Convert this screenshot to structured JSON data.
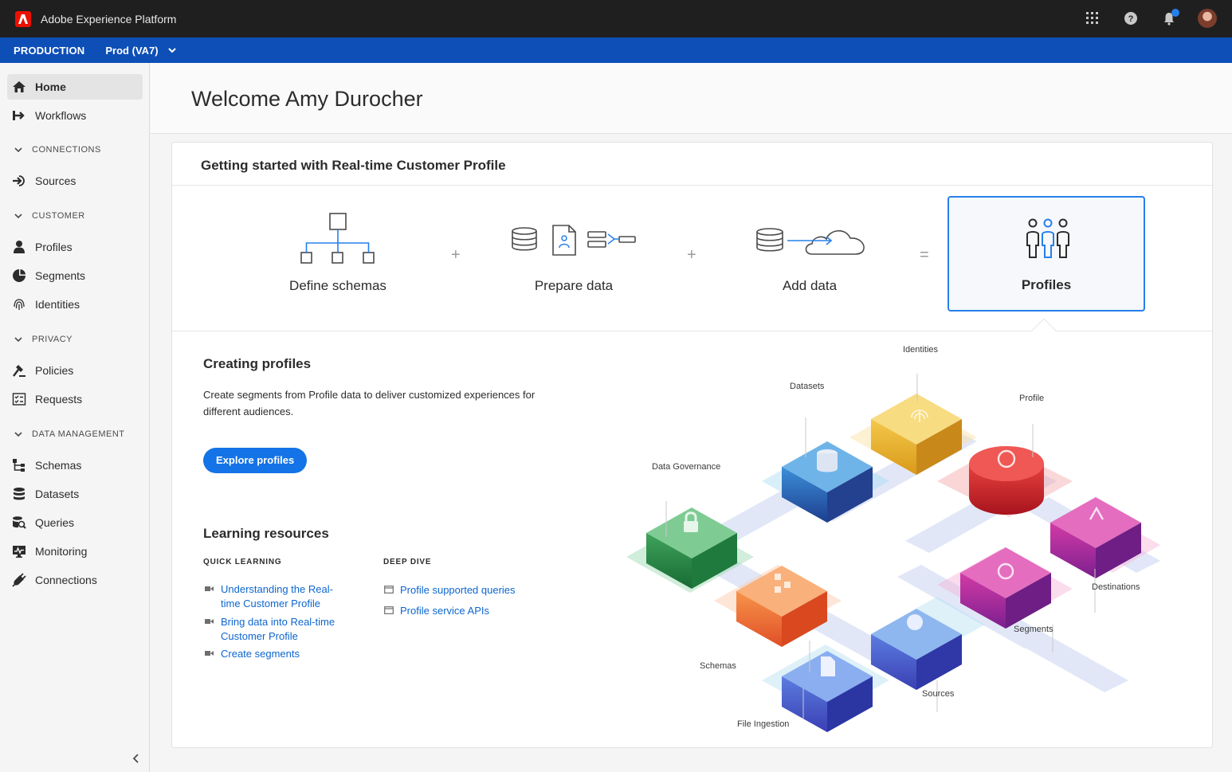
{
  "header": {
    "app_title": "Adobe Experience Platform",
    "icons": [
      "apps-grid-icon",
      "help-icon",
      "notifications-icon",
      "user-avatar"
    ]
  },
  "envbar": {
    "environment": "PRODUCTION",
    "sandbox": "Prod (VA7)"
  },
  "sidebar": {
    "items": [
      {
        "label": "Home",
        "icon": "home-icon",
        "active": true
      },
      {
        "label": "Workflows",
        "icon": "workflows-icon"
      }
    ],
    "sections": [
      {
        "title": "CONNECTIONS",
        "items": [
          {
            "label": "Sources",
            "icon": "sources-icon"
          }
        ]
      },
      {
        "title": "CUSTOMER",
        "items": [
          {
            "label": "Profiles",
            "icon": "profiles-icon"
          },
          {
            "label": "Segments",
            "icon": "segments-icon"
          },
          {
            "label": "Identities",
            "icon": "identities-icon"
          }
        ]
      },
      {
        "title": "PRIVACY",
        "items": [
          {
            "label": "Policies",
            "icon": "policies-icon"
          },
          {
            "label": "Requests",
            "icon": "requests-icon"
          }
        ]
      },
      {
        "title": "DATA MANAGEMENT",
        "items": [
          {
            "label": "Schemas",
            "icon": "schemas-icon"
          },
          {
            "label": "Datasets",
            "icon": "datasets-icon"
          },
          {
            "label": "Queries",
            "icon": "queries-icon"
          },
          {
            "label": "Monitoring",
            "icon": "monitoring-icon"
          },
          {
            "label": "Connections",
            "icon": "connections-icon"
          }
        ]
      }
    ]
  },
  "main": {
    "welcome": "Welcome Amy Durocher",
    "card_title": "Getting started with Real-time Customer Profile",
    "steps": [
      "Define schemas",
      "Prepare data",
      "Add data",
      "Profiles"
    ],
    "operators": [
      "+",
      "+",
      "="
    ],
    "creating": {
      "title": "Creating profiles",
      "description": "Create segments from Profile data to deliver customized experiences for different audiences.",
      "button": "Explore profiles"
    },
    "learning": {
      "title": "Learning resources",
      "quick_learning": {
        "heading": "QUICK LEARNING",
        "links": [
          "Understanding the Real-time Customer Profile",
          "Bring data into Real-time Customer Profile",
          "Create segments"
        ]
      },
      "deep_dive": {
        "heading": "DEEP DIVE",
        "links": [
          "Profile supported queries",
          "Profile service APIs"
        ]
      }
    },
    "illustration_labels": {
      "identities": "Identities",
      "datasets": "Datasets",
      "profile": "Profile",
      "data_governance": "Data Governance",
      "destinations": "Destinations",
      "segments": "Segments",
      "schemas": "Schemas",
      "sources": "Sources",
      "file_ingestion": "File Ingestion"
    }
  },
  "colors": {
    "topbar": "#1f1f1f",
    "envbar": "#0d4fb7",
    "accent": "#1473e6",
    "link": "#0d66d0",
    "adobe_red": "#eb1000"
  }
}
